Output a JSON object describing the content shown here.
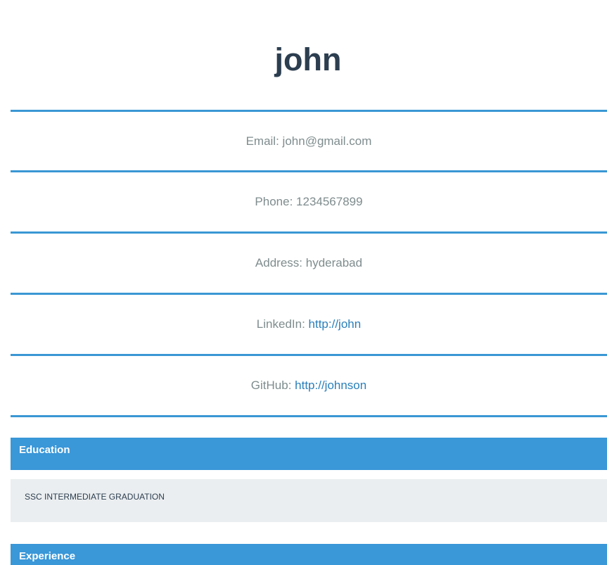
{
  "profile": {
    "name": "john"
  },
  "contact": {
    "email_label": "Email: ",
    "email_value": "john@gmail.com",
    "phone_label": "Phone: ",
    "phone_value": "1234567899",
    "address_label": "Address: ",
    "address_value": "hyderabad",
    "linkedin_label": "LinkedIn: ",
    "linkedin_link": "http://john",
    "github_label": "GitHub: ",
    "github_link": "http://johnson"
  },
  "sections": {
    "education": {
      "title": "Education",
      "content": "SSC INTERMEDIATE GRADUATION"
    },
    "experience": {
      "title": "Experience"
    }
  },
  "colors": {
    "accent": "#3a97d4",
    "title": "#2c3e50",
    "muted_text": "#7f8c8d",
    "link": "#2a7fba",
    "panel_bg": "#ebeef0"
  }
}
